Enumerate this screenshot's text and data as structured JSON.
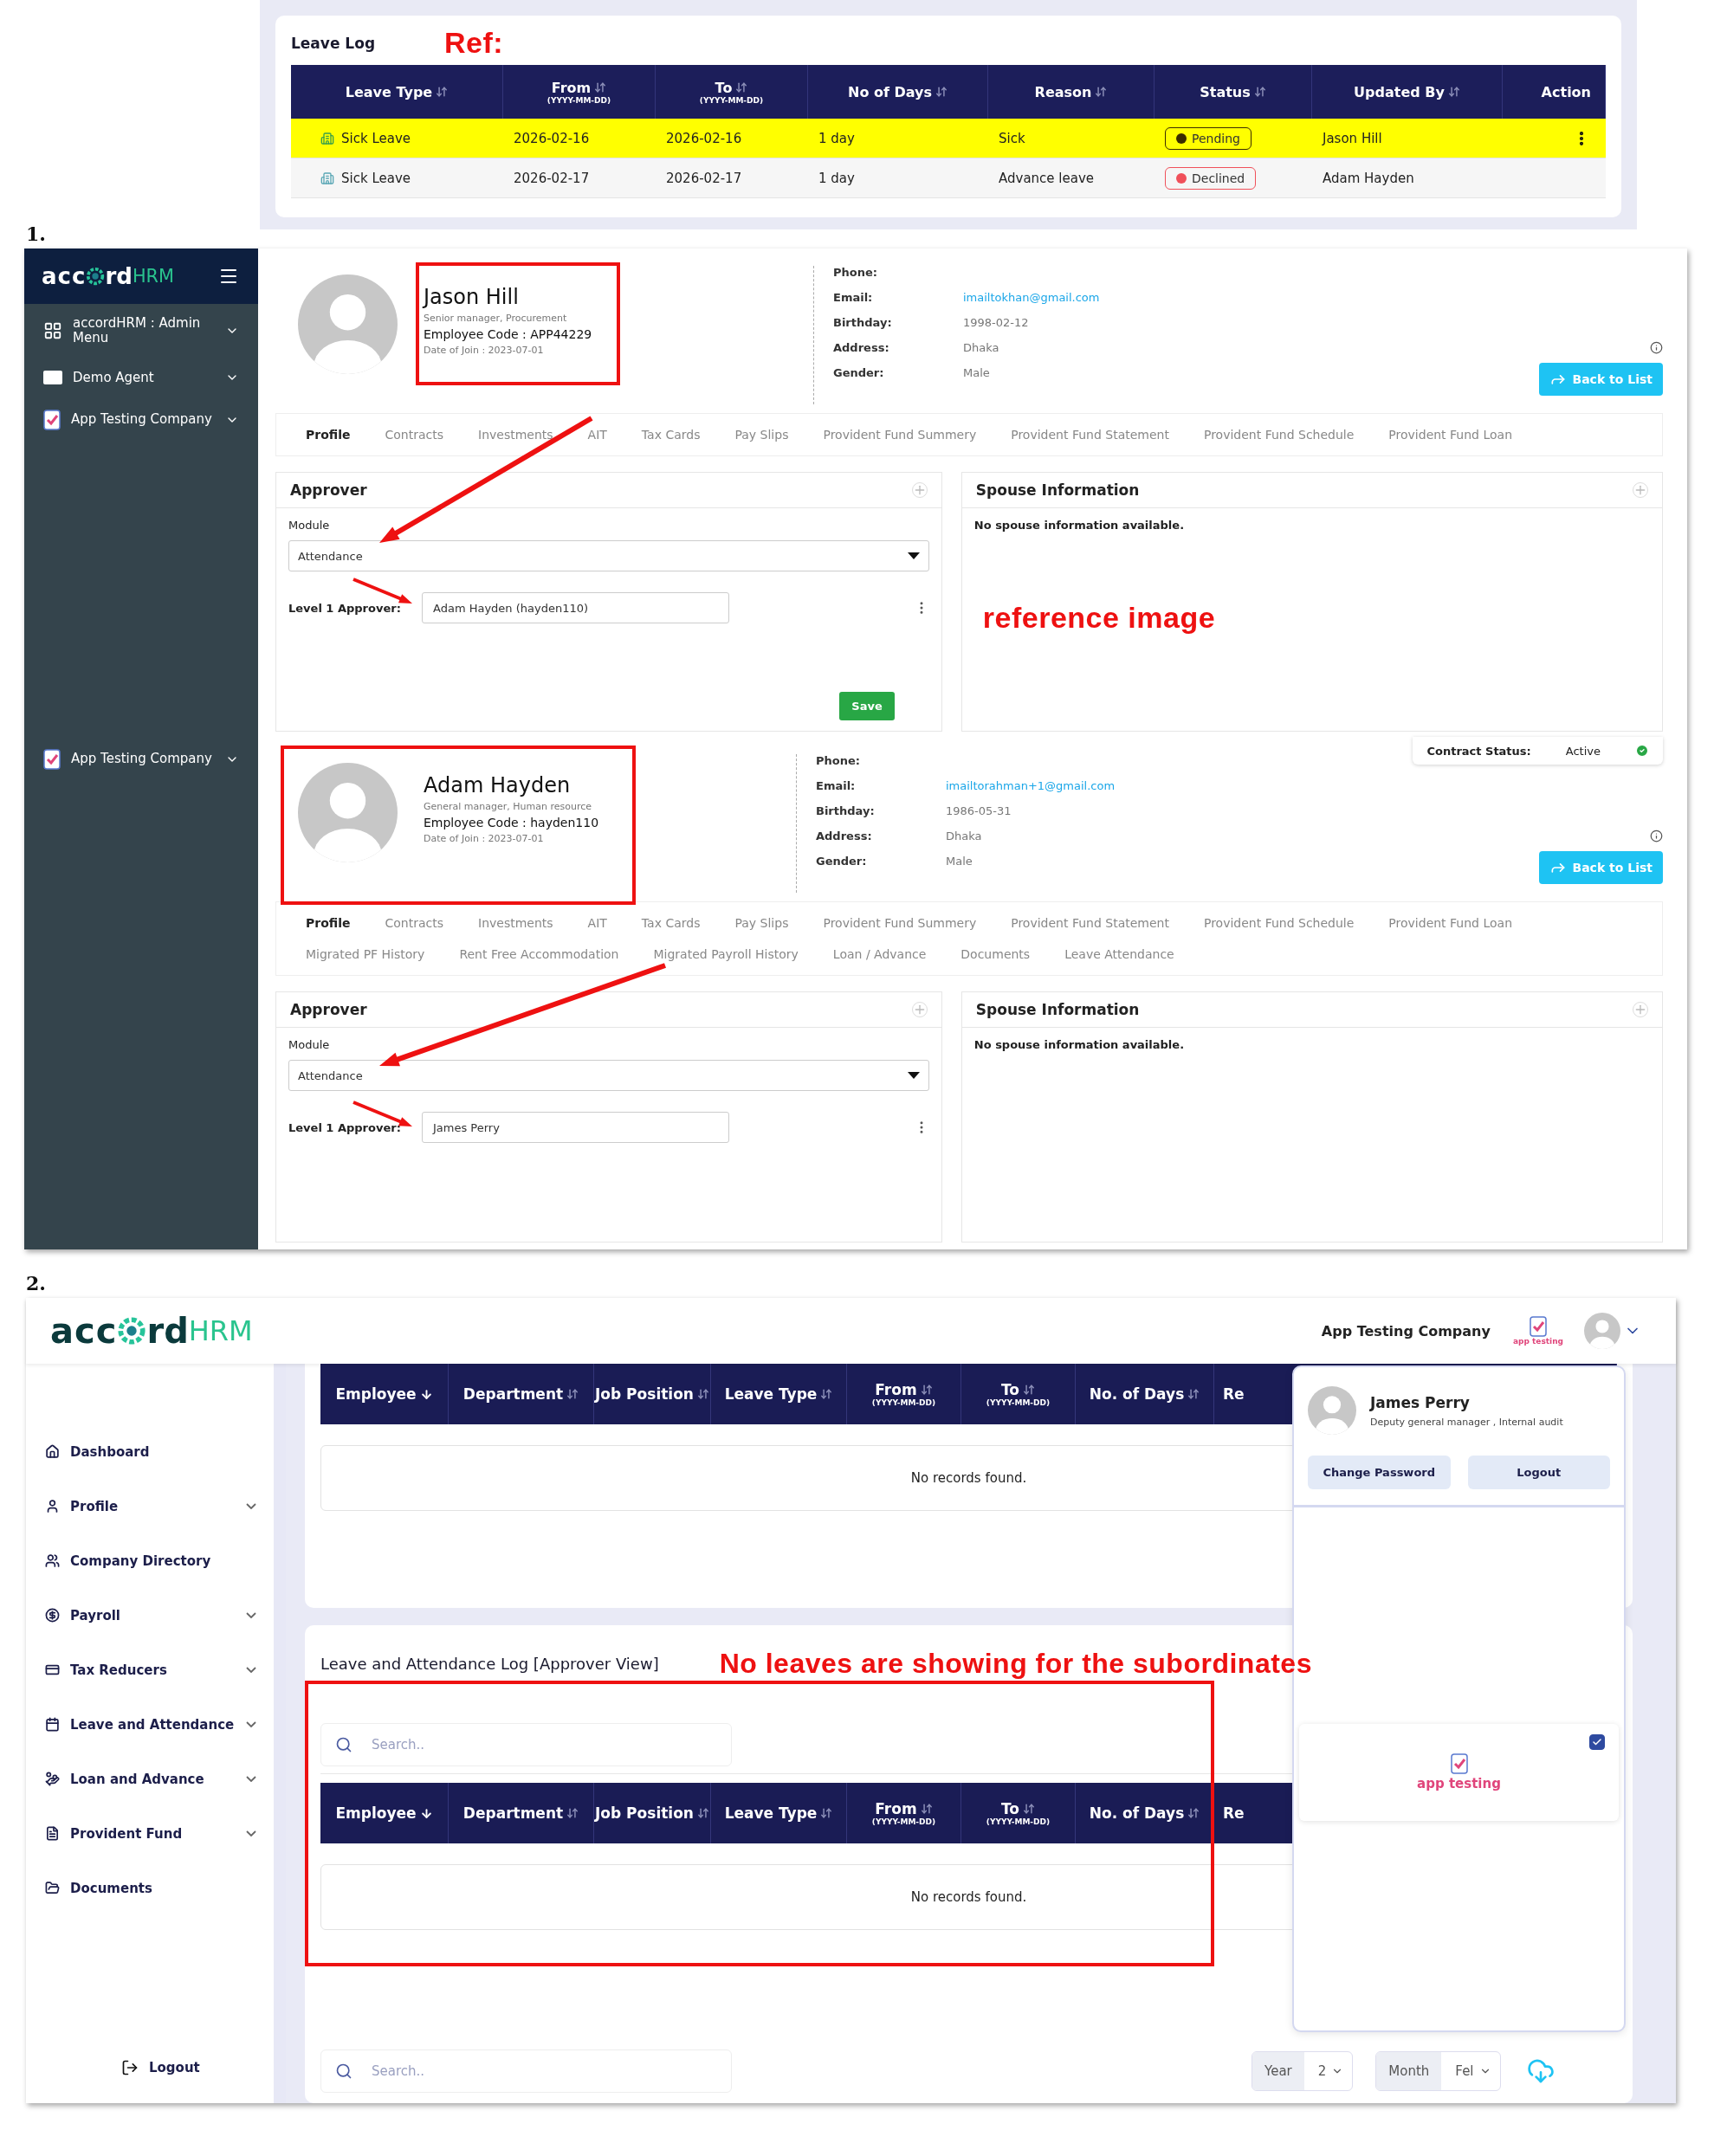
{
  "annotations": {
    "step_1": "1.",
    "step_2": "2.",
    "ref_label": "Ref:",
    "reference_note": "reference image",
    "issue_note": "No leaves are showing for the subordinates"
  },
  "leave_log": {
    "title": "Leave Log",
    "columns": [
      {
        "label": "Leave Type",
        "sortable": true
      },
      {
        "label": "From",
        "sub": "(YYYY-MM-DD)",
        "sortable": true
      },
      {
        "label": "To",
        "sub": "(YYYY-MM-DD)",
        "sortable": true
      },
      {
        "label": "No of Days",
        "sortable": true
      },
      {
        "label": "Reason",
        "sortable": true
      },
      {
        "label": "Status",
        "sortable": true
      },
      {
        "label": "Updated By",
        "sortable": true
      },
      {
        "label": "Action",
        "sortable": false
      }
    ],
    "rows": [
      {
        "leave_type": "Sick Leave",
        "from": "2026-02-16",
        "to": "2026-02-16",
        "days": "1 day",
        "reason": "Sick",
        "status": "Pending",
        "color": "#3a2c00",
        "updated_by": "Jason Hill",
        "highlighted": true,
        "action_menu": true
      },
      {
        "leave_type": "Sick Leave",
        "from": "2026-02-17",
        "to": "2026-02-17",
        "days": "1 day",
        "reason": "Advance leave",
        "status": "Declined",
        "color": "#f0505a",
        "updated_by": "Adam Hayden",
        "highlighted": false,
        "action_menu": false
      }
    ]
  },
  "screenshot_1": {
    "logo": {
      "prefix": "acc",
      "suffix": "rd",
      "accent": "HRM"
    },
    "strips": [
      {
        "sidebar_items": [
          {
            "label": "accordHRM : Admin Menu",
            "kind": "grid"
          },
          {
            "label": "Demo Agent",
            "kind": "badge"
          },
          {
            "label": "App Testing Company",
            "kind": "app"
          }
        ],
        "profile": {
          "kind": "name",
          "name": "Jason Hill",
          "designation": "Senior manager, Procurement",
          "employee_code": "Employee Code : APP44229",
          "join_date": "Date of Join : 2023-07-01",
          "details": [
            {
              "label": "Phone:"
            },
            {
              "label": "Email:",
              "value": "imailtokhan@gmail.com",
              "link": true
            },
            {
              "label": "Birthday:",
              "value": "1998-02-12",
              "link": false
            },
            {
              "label": "Address:",
              "value": "Dhaka",
              "link": false
            },
            {
              "label": "Gender:",
              "value": "Male",
              "link": false
            }
          ],
          "back_button": "Back to List",
          "tabs": [
            {
              "label": "Profile",
              "selected": true
            },
            {
              "label": "Contracts",
              "selected": false
            },
            {
              "label": "Investments",
              "selected": false
            },
            {
              "label": "AIT",
              "selected": false
            },
            {
              "label": "Tax Cards",
              "selected": false
            },
            {
              "label": "Pay Slips",
              "selected": false
            },
            {
              "label": "Provident Fund Summery",
              "selected": false
            },
            {
              "label": "Provident Fund Statement",
              "selected": false
            },
            {
              "label": "Provident Fund Schedule",
              "selected": false
            },
            {
              "label": "Provident Fund Loan",
              "selected": false
            }
          ],
          "approver": {
            "title": "Approver",
            "module_label": "Module",
            "module": "Attendance",
            "level_label": "Level 1 Approver:",
            "approver": "Adam Hayden (hayden110)",
            "save": "Save"
          },
          "spouse": {
            "title": "Spouse Information",
            "empty": "No spouse information available."
          }
        }
      },
      {
        "sidebar_items": [
          {
            "label": "App Testing Company",
            "kind": "app"
          }
        ],
        "profile": {
          "kind": "card",
          "name": "Adam Hayden",
          "designation": "General manager, Human resource",
          "employee_code": "Employee Code : hayden110",
          "join_date": "Date of Join : 2023-07-01",
          "contract_status": {
            "label": "Contract Status:",
            "value": "Active"
          },
          "details": [
            {
              "label": "Phone:"
            },
            {
              "label": "Email:",
              "value": "imailtorahman+1@gmail.com",
              "link": true
            },
            {
              "label": "Birthday:",
              "value": "1986-05-31",
              "link": false
            },
            {
              "label": "Address:",
              "value": "Dhaka",
              "link": false
            },
            {
              "label": "Gender:",
              "value": "Male",
              "link": false
            }
          ],
          "back_button": "Back to List",
          "tabs": [
            {
              "label": "Profile",
              "selected": true
            },
            {
              "label": "Contracts",
              "selected": false
            },
            {
              "label": "Investments",
              "selected": false
            },
            {
              "label": "AIT",
              "selected": false
            },
            {
              "label": "Tax Cards",
              "selected": false
            },
            {
              "label": "Pay Slips",
              "selected": false
            },
            {
              "label": "Provident Fund Summery",
              "selected": false
            },
            {
              "label": "Provident Fund Statement",
              "selected": false
            },
            {
              "label": "Provident Fund Schedule",
              "selected": false
            },
            {
              "label": "Provident Fund Loan",
              "selected": false
            },
            {
              "label": "Migrated PF History",
              "selected": false
            },
            {
              "label": "Rent Free Accommodation",
              "selected": false
            },
            {
              "label": "Migrated Payroll History",
              "selected": false
            },
            {
              "label": "Loan / Advance",
              "selected": false
            },
            {
              "label": "Documents",
              "selected": false
            },
            {
              "label": "Leave Attendance",
              "selected": false
            }
          ],
          "approver": {
            "title": "Approver",
            "module_label": "Module",
            "module": "Attendance",
            "level_label": "Level 1 Approver:",
            "approver": "James Perry"
          },
          "spouse": {
            "title": "Spouse Information",
            "empty": "No spouse information available."
          }
        }
      }
    ]
  },
  "screenshot_2": {
    "logo": {
      "prefix": "acc",
      "suffix": "rd",
      "accent": "HRM"
    },
    "company": "App Testing Company",
    "app_badge": "app testing",
    "nav": [
      {
        "label": "Dashboard",
        "expandable": false
      },
      {
        "label": "Profile",
        "expandable": true
      },
      {
        "label": "Company Directory",
        "expandable": false
      },
      {
        "label": "Payroll",
        "expandable": true
      },
      {
        "label": "Tax Reducers",
        "expandable": true
      },
      {
        "label": "Leave and Attendance",
        "expandable": true
      },
      {
        "label": "Loan and Advance",
        "expandable": true
      },
      {
        "label": "Provident Fund",
        "expandable": true
      },
      {
        "label": "Documents",
        "expandable": false
      }
    ],
    "logout": "Logout",
    "top_table": {
      "columns": [
        {
          "label": "Employee",
          "sort_active": true
        },
        {
          "label": "Department",
          "sort_active": false
        },
        {
          "label": "Job Position",
          "sort_active": false
        },
        {
          "label": "Leave Type",
          "sort_active": false
        },
        {
          "label": "From",
          "sub": "(YYYY-MM-DD)",
          "sort_active": false
        },
        {
          "label": "To",
          "sub": "(YYYY-MM-DD)",
          "sort_active": false
        },
        {
          "label": "No. of Days",
          "sort_active": false
        },
        {
          "label": "Re"
        }
      ],
      "empty": "No records found."
    },
    "approver_log": {
      "title": "Leave and Attendance Log [Approver View]",
      "search_placeholder": "Search..",
      "columns": [
        {
          "label": "Employee",
          "sort_active": true
        },
        {
          "label": "Department",
          "sort_active": false
        },
        {
          "label": "Job Position",
          "sort_active": false
        },
        {
          "label": "Leave Type",
          "sort_active": false
        },
        {
          "label": "From",
          "sub": "(YYYY-MM-DD)",
          "sort_active": false
        },
        {
          "label": "To",
          "sub": "(YYYY-MM-DD)",
          "sort_active": false
        },
        {
          "label": "No. of Days",
          "sort_active": false
        },
        {
          "label": "Re"
        }
      ],
      "empty": "No records found."
    },
    "filters": {
      "search_placeholder": "Search..",
      "year_label": "Year",
      "year_value": "2",
      "month_label": "Month",
      "month_value": "Fel"
    },
    "user_menu": {
      "name": "James Perry",
      "role": "Deputy general manager , Internal audit",
      "buttons": [
        "Change Password",
        "Logout"
      ],
      "company_card": {
        "label": "app testing",
        "checked": true
      }
    }
  }
}
